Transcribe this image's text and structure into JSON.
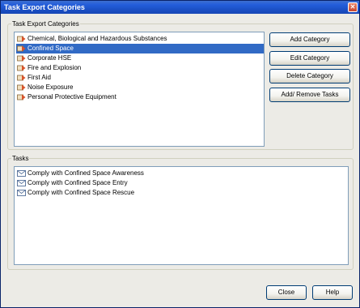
{
  "window": {
    "title": "Task Export Categories",
    "close_glyph": "✕"
  },
  "categories": {
    "legend": "Task Export Categories",
    "items": [
      {
        "label": "Chemical, Biological and Hazardous Substances",
        "icon": "category-icon",
        "selected": false
      },
      {
        "label": "Confined Space",
        "icon": "category-icon",
        "selected": true
      },
      {
        "label": "Corporate HSE",
        "icon": "category-icon",
        "selected": false
      },
      {
        "label": "Fire and Explosion",
        "icon": "category-icon",
        "selected": false
      },
      {
        "label": "First Aid",
        "icon": "category-icon",
        "selected": false
      },
      {
        "label": "Noise Exposure",
        "icon": "category-icon",
        "selected": false
      },
      {
        "label": "Personal Protective Equipment",
        "icon": "category-icon",
        "selected": false
      }
    ]
  },
  "buttons": {
    "add_category": "Add Category",
    "edit_category": "Edit Category",
    "delete_category": "Delete Category",
    "add_remove_tasks": "Add/ Remove Tasks",
    "close": "Close",
    "help": "Help"
  },
  "tasks": {
    "legend": "Tasks",
    "items": [
      {
        "label": "Comply with Confined Space Awareness",
        "icon": "task-icon"
      },
      {
        "label": "Comply with Confined Space Entry",
        "icon": "task-icon"
      },
      {
        "label": "Comply with Confined Space Rescue",
        "icon": "task-icon"
      }
    ]
  },
  "colors": {
    "title_bar": "#245edb",
    "selection": "#316ac5",
    "dialog_bg": "#ecebe6"
  }
}
